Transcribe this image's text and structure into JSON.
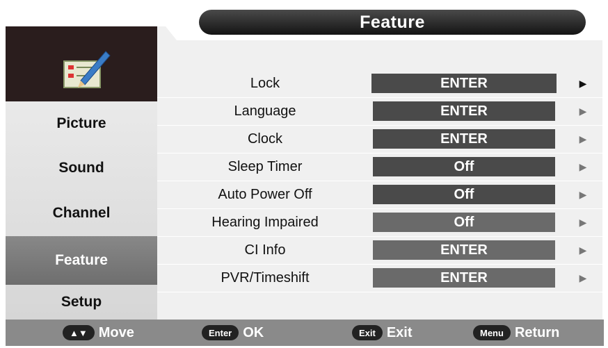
{
  "header": {
    "title": "Feature"
  },
  "sidebar": {
    "items": [
      {
        "label": "Picture"
      },
      {
        "label": "Sound"
      },
      {
        "label": "Channel"
      },
      {
        "label": "Feature",
        "active": true
      },
      {
        "label": "Setup"
      }
    ]
  },
  "menu": {
    "rows": [
      {
        "label": "Lock",
        "value": "ENTER"
      },
      {
        "label": "Language",
        "value": "ENTER"
      },
      {
        "label": "Clock",
        "value": "ENTER"
      },
      {
        "label": "Sleep Timer",
        "value": "Off"
      },
      {
        "label": "Auto Power Off",
        "value": "Off"
      },
      {
        "label": "Hearing Impaired",
        "value": "Off"
      },
      {
        "label": "CI Info",
        "value": "ENTER"
      },
      {
        "label": "PVR/Timeshift",
        "value": "ENTER"
      }
    ]
  },
  "footer": {
    "move": {
      "key": "▲▼",
      "label": "Move"
    },
    "ok": {
      "key": "Enter",
      "label": "OK"
    },
    "exit": {
      "key": "Exit",
      "label": "Exit"
    },
    "return": {
      "key": "Menu",
      "label": "Return"
    }
  },
  "colors": {
    "accent": "#4a4a4a",
    "active_sidebar": "#7a7a7a",
    "header": "#1e1e1e"
  },
  "icons": {
    "feature": "clipboard-pencil-icon",
    "row_arrow": "triangle-right-icon"
  }
}
